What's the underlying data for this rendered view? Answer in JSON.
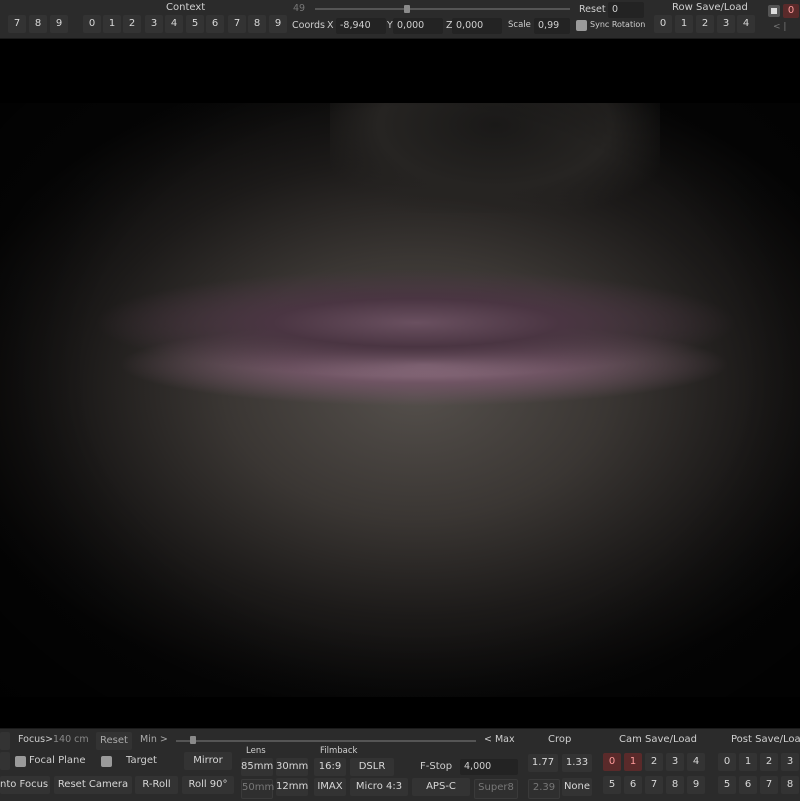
{
  "top": {
    "left_digits": [
      "7",
      "8",
      "9"
    ],
    "context_label": "Context",
    "context_digits": [
      "0",
      "1",
      "2",
      "3",
      "4",
      "5",
      "6",
      "7",
      "8",
      "9"
    ],
    "slider_value": "49",
    "reset_label": "Reset",
    "reset_value": "0",
    "coords_label": "Coords",
    "x_label": "X",
    "x_value": "-8,940",
    "y_label": "Y",
    "y_value": "0,000",
    "z_label": "Z",
    "z_value": "0,000",
    "scale_label": "Scale",
    "scale_value": "0,99",
    "sync_rotation_label": "Sync Rotation",
    "row_save_load_label": "Row Save/Load",
    "row_digits": [
      "0",
      "1",
      "2",
      "3",
      "4"
    ],
    "right_value": "0",
    "right_arrows": "< |"
  },
  "bottom": {
    "focus_label": "Focus>",
    "focus_value": "140 cm",
    "reset_label": "Reset",
    "min_label": "Min >",
    "max_label": "< Max",
    "focal_plane_label": "Focal Plane",
    "target_label": "Target",
    "mirror_label": "Mirror",
    "auto_focus_label": "nto Focus",
    "reset_camera_label": "Reset Camera",
    "r_roll_label": "R-Roll",
    "roll90_label": "Roll 90°",
    "lens_label": "Lens",
    "lens": [
      "85mm",
      "30mm",
      "50mm",
      "12mm"
    ],
    "filmback_label": "Filmback",
    "filmback": [
      "16:9",
      "DSLR",
      "IMAX",
      "Micro 4:3"
    ],
    "fstop_label": "F-Stop",
    "fstop_value": "4,000",
    "apsc_label": "APS-C",
    "super8_label": "Super8",
    "crop_label": "Crop",
    "crop": [
      "1.77",
      "1.33",
      "2.39",
      "None"
    ],
    "cam_save_load_label": "Cam Save/Load",
    "cam_row1": [
      "0",
      "1",
      "2",
      "3",
      "4"
    ],
    "cam_row2": [
      "5",
      "6",
      "7",
      "8",
      "9"
    ],
    "post_save_load_label": "Post Save/Load",
    "post_row1": [
      "0",
      "1",
      "2",
      "3"
    ],
    "post_row2": [
      "5",
      "6",
      "7",
      "8"
    ]
  },
  "colors": {
    "panel": "#2b2b2b",
    "button": "#333333",
    "active_button": "#5a2a2a"
  }
}
